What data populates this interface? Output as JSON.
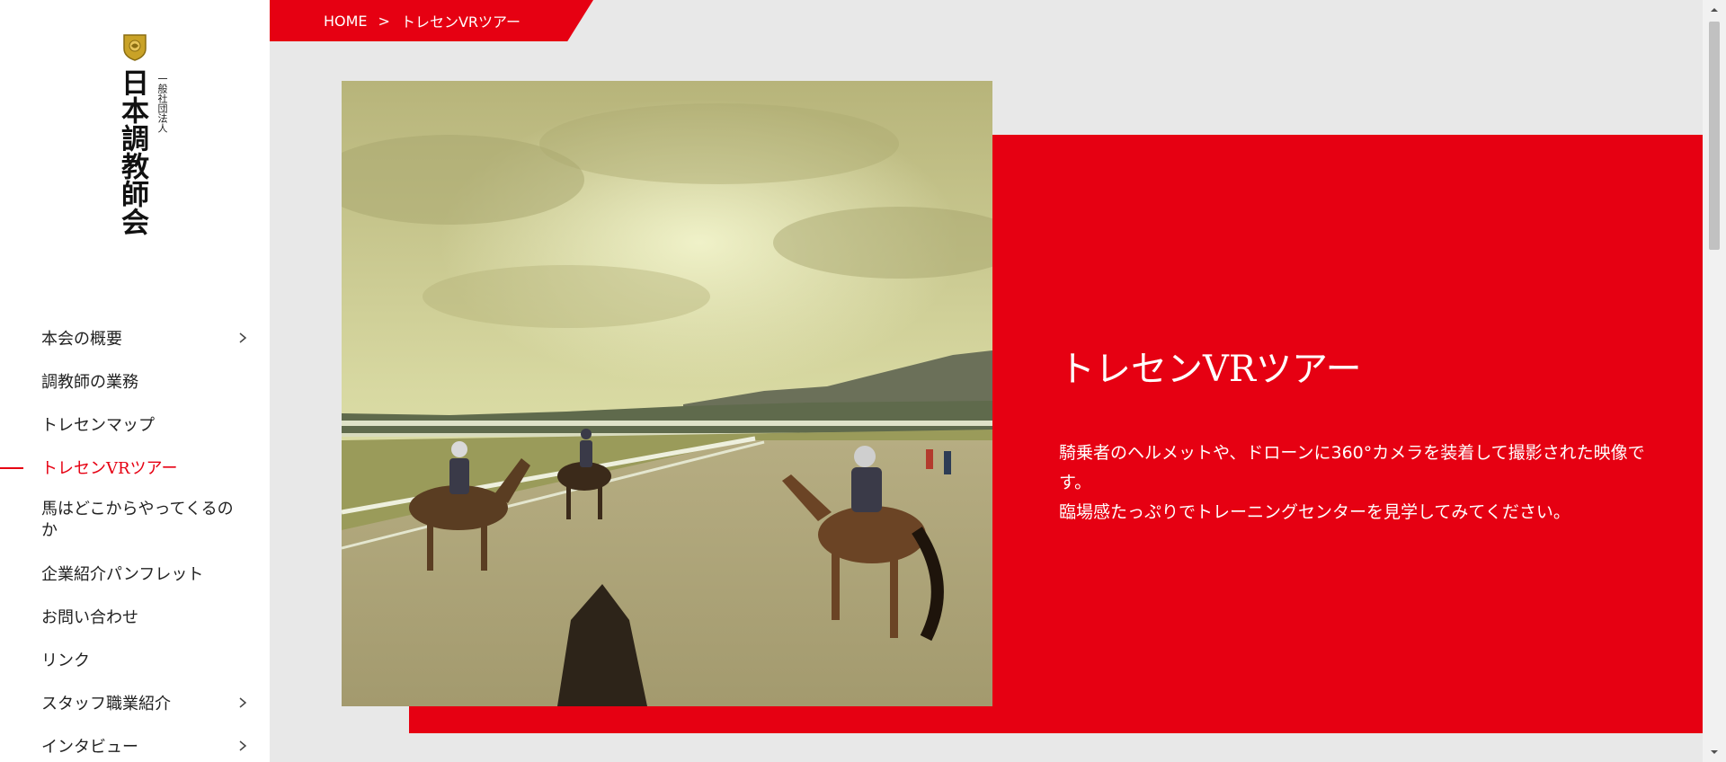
{
  "sidebar": {
    "logo": {
      "subtitle": "一般社団法人",
      "name": "日本調教師会"
    },
    "nav": [
      {
        "label": "本会の概要",
        "has_submenu": true,
        "active": false
      },
      {
        "label": "調教師の業務",
        "has_submenu": false,
        "active": false
      },
      {
        "label": "トレセンマップ",
        "has_submenu": false,
        "active": false
      },
      {
        "label": "トレセンVRツアー",
        "has_submenu": false,
        "active": true
      },
      {
        "label": "馬はどこからやってくるのか",
        "has_submenu": false,
        "active": false
      },
      {
        "label": "企業紹介パンフレット",
        "has_submenu": false,
        "active": false
      },
      {
        "label": "お問い合わせ",
        "has_submenu": false,
        "active": false
      },
      {
        "label": "リンク",
        "has_submenu": false,
        "active": false
      },
      {
        "label": "スタッフ職業紹介",
        "has_submenu": true,
        "active": false
      },
      {
        "label": "インタビュー",
        "has_submenu": true,
        "active": false
      }
    ]
  },
  "breadcrumb": {
    "home": "HOME",
    "separator": ">",
    "current": "トレセンVRツアー"
  },
  "hero": {
    "title": "トレセンVRツアー",
    "description_line1": "騎乗者のヘルメットや、ドローンに360°カメラを装着して撮影された映像です。",
    "description_line2": "臨場感たっぷりでトレーニングセンターを見学してみてください。",
    "photo_alt_icon": "training-track-photo"
  },
  "colors": {
    "accent": "#e60012",
    "background": "#e8e8e8",
    "sidebar": "#ffffff",
    "text": "#222222"
  }
}
